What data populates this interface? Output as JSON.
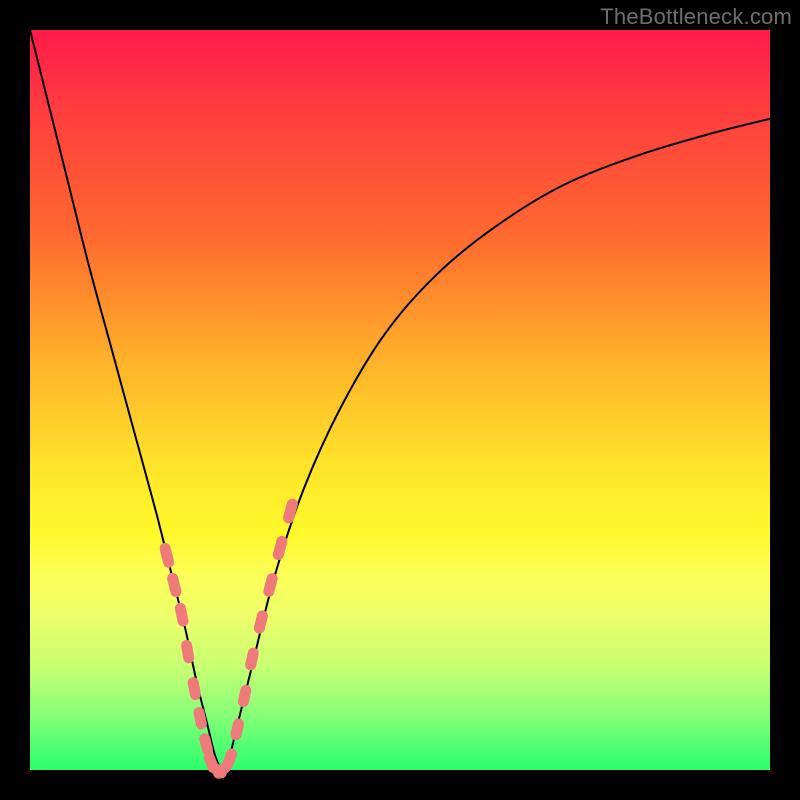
{
  "watermark": "TheBottleneck.com",
  "gradient_colors": {
    "top": "#ff1a4d",
    "mid1": "#ffb32a",
    "mid2": "#fff92a",
    "bottom": "#2aff6e"
  },
  "chart_data": {
    "type": "line",
    "title": "",
    "xlabel": "",
    "ylabel": "",
    "xlim": [
      0,
      100
    ],
    "ylim": [
      0,
      100
    ],
    "series": [
      {
        "name": "bottleneck-curve",
        "x": [
          0,
          2,
          5,
          8,
          11,
          14,
          17,
          19,
          21,
          22.5,
          24,
          25,
          26,
          27,
          28,
          30,
          33,
          37,
          42,
          48,
          55,
          63,
          72,
          82,
          92,
          100
        ],
        "y": [
          100,
          92,
          80,
          68,
          57,
          46,
          35,
          27,
          19,
          12,
          6,
          2,
          0,
          2,
          6,
          14,
          26,
          38,
          49,
          59,
          67,
          73.5,
          79,
          83,
          86,
          88
        ]
      }
    ],
    "markers": {
      "name": "highlighted-points",
      "x": [
        18.5,
        19.5,
        20.5,
        21.3,
        22.2,
        23.0,
        23.8,
        24.5,
        25.3,
        26.0,
        27.0,
        28.0,
        29.0,
        30.0,
        31.2,
        32.5,
        33.8,
        35.2
      ],
      "y": [
        29.0,
        25.0,
        21.0,
        16.0,
        11.0,
        7.0,
        3.5,
        1.0,
        0.0,
        0.0,
        1.5,
        5.5,
        10.0,
        15.0,
        20.0,
        25.0,
        30.0,
        35.0
      ]
    }
  }
}
